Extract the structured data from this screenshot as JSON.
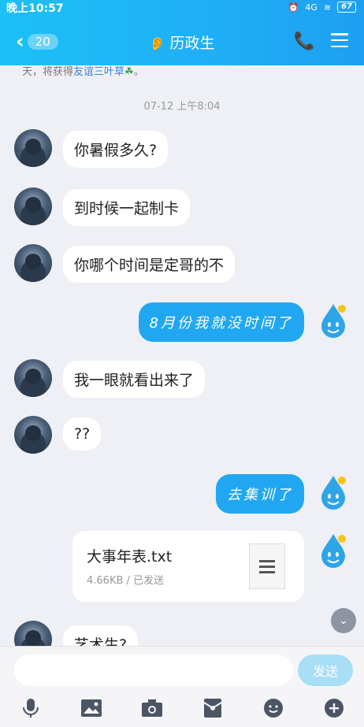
{
  "status_bar": {
    "time": "晚上10:57",
    "battery": "67",
    "signal": "4G"
  },
  "nav": {
    "unread_count": "20",
    "title": "历政生"
  },
  "notice": {
    "prefix": "天，将获得",
    "link": "友谊三叶草",
    "suffix": "。"
  },
  "timestamp": "07-12 上午8:04",
  "messages": [
    {
      "side": "left",
      "text": "你暑假多久?"
    },
    {
      "side": "left",
      "text": "到时候一起制卡"
    },
    {
      "side": "left",
      "text": "你哪个时间是定哥的不"
    },
    {
      "side": "right",
      "text": "8月份我就没时间了"
    },
    {
      "side": "left",
      "text": "我一眼就看出来了"
    },
    {
      "side": "left",
      "text": "??"
    },
    {
      "side": "right",
      "text": "去集训了"
    },
    {
      "side": "left",
      "text": "艺术生?"
    }
  ],
  "file_message": {
    "name": "大事年表.txt",
    "meta": "4.66KB / 已发送"
  },
  "composer": {
    "placeholder": "",
    "send_label": "发送"
  },
  "toolbar_icons": [
    "microphone-icon",
    "image-icon",
    "camera-icon",
    "red-packet-icon",
    "emoji-icon",
    "plus-icon"
  ],
  "colors": {
    "header_start": "#1cc0f6",
    "header_end": "#1d9ff1",
    "bubble_sent": "#21a7f2",
    "send_disabled": "#a8def6"
  }
}
